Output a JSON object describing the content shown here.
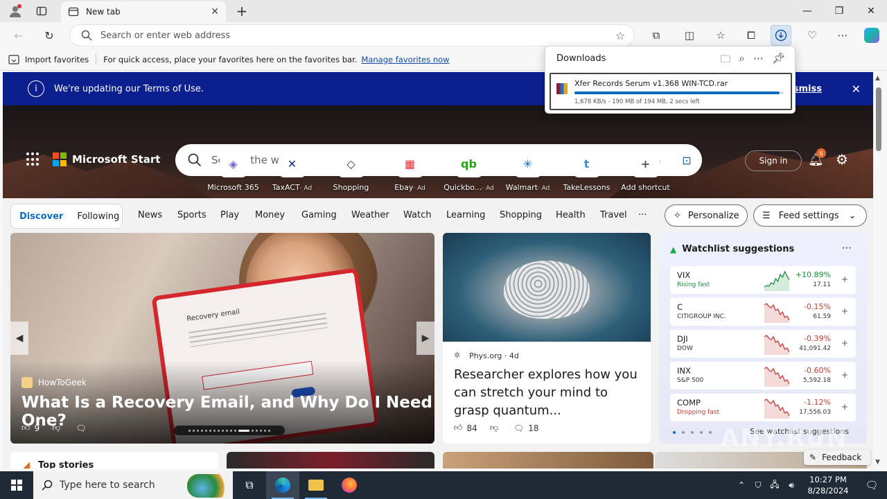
{
  "browser": {
    "tab_title": "New tab",
    "address_placeholder": "Search or enter web address",
    "window_controls": {
      "minimize": "—",
      "maximize": "❐",
      "close": "✕"
    }
  },
  "favbar": {
    "import_label": "Import favorites",
    "message": "For quick access, place your favorites here on the favorites bar.",
    "manage_link": "Manage favorites now"
  },
  "downloads": {
    "title": "Downloads",
    "file_name": "Xfer Records Serum v1.368 WIN-TCD.rar",
    "status": "1,678 KB/s - 190 MB of 194 MB, 2 secs left",
    "progress_fraction": 0.979
  },
  "banner": {
    "message": "We're updating our Terms of Use.",
    "dismiss": "Dismiss"
  },
  "start": {
    "brand": "Microsoft Start",
    "search_placeholder": "Search the web",
    "sign_in": "Sign in",
    "notification_count": "6",
    "tiles": [
      {
        "label": "Microsoft 365",
        "ad": "",
        "glyph": "◈",
        "color": "#7b5cd6"
      },
      {
        "label": "TaxACT",
        "ad": "· Ad",
        "glyph": "✕",
        "color": "#1a2b6b"
      },
      {
        "label": "Shopping",
        "ad": "",
        "glyph": "◇",
        "color": "#333333"
      },
      {
        "label": "Ebay",
        "ad": "· Ad",
        "glyph": "▦",
        "color": "#e53238"
      },
      {
        "label": "Quickbo...",
        "ad": "· Ad",
        "glyph": "qb",
        "color": "#2ca01c"
      },
      {
        "label": "Walmart",
        "ad": "· Ad",
        "glyph": "✳",
        "color": "#0071dc"
      },
      {
        "label": "TakeLessons",
        "ad": "",
        "glyph": "t",
        "color": "#3b8fd6"
      },
      {
        "label": "Add shortcut",
        "ad": "",
        "glyph": "+",
        "color": "#555555"
      }
    ]
  },
  "nav": {
    "discover": "Discover",
    "following": "Following",
    "categories": [
      "News",
      "Sports",
      "Play",
      "Money",
      "Gaming",
      "Weather",
      "Watch",
      "Learning",
      "Shopping",
      "Health",
      "Travel",
      "···"
    ],
    "personalize": "Personalize",
    "feed_settings": "Feed settings"
  },
  "main_card": {
    "mock_title": "Recovery email",
    "source": "HowToGeek",
    "headline": "What Is a Recovery Email, and Why Do I Need One?",
    "likes": "9"
  },
  "side_card": {
    "source": "Phys.org · 4d",
    "headline": "Researcher explores how you can stretch your mind to grasp quantum...",
    "likes": "84",
    "comments": "18"
  },
  "watchlist": {
    "title": "Watchlist suggestions",
    "see_all": "See watchlist suggestions",
    "colors": {
      "up": "#1a8f3c",
      "down": "#c43a31"
    },
    "stocks": [
      {
        "symbol": "VIX",
        "name": "Rising fast",
        "change": "+10.89%",
        "price": "17.11",
        "trend": "up"
      },
      {
        "symbol": "C",
        "name": "CITIGROUP INC.",
        "change": "-0.15%",
        "price": "61.59",
        "trend": "down"
      },
      {
        "symbol": "DJI",
        "name": "DOW",
        "change": "-0.39%",
        "price": "41,091.42",
        "trend": "down"
      },
      {
        "symbol": "INX",
        "name": "S&P 500",
        "change": "-0.60%",
        "price": "5,592.18",
        "trend": "down"
      },
      {
        "symbol": "COMP",
        "name": "Dropping fast",
        "change": "-1.12%",
        "price": "17,556.03",
        "trend": "down"
      }
    ]
  },
  "bottom": {
    "top_stories": "Top stories",
    "feedback": "Feedback",
    "watermark": "ANY.RUN"
  },
  "taskbar": {
    "search_placeholder": "Type here to search",
    "time": "10:27 PM",
    "date": "8/28/2024"
  }
}
